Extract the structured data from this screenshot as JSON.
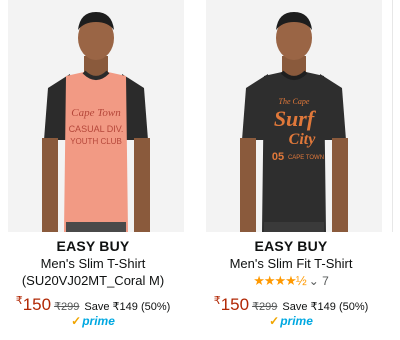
{
  "products": [
    {
      "brand": "EASY BUY",
      "title_line1": "Men's Slim T-Shirt",
      "title_line2": "(SU20VJ02MT_Coral M)",
      "currency": "₹",
      "price": "150",
      "mrp": "₹299",
      "save": "Save ₹149 (50%)",
      "prime": "prime",
      "shirt_print": [
        "Cape Town",
        "CASUAL DIV.",
        "YOUTH CLUB"
      ],
      "body_color": "#f29a84",
      "sleeve_color": "#2b2b2b",
      "print_color": "#b5473a"
    },
    {
      "brand": "EASY BUY",
      "title_line1": "Men's Slim Fit T-Shirt",
      "rating_value": 4.5,
      "stars": "★★★★½",
      "rating_sep": "⌄",
      "rating_count": "7",
      "currency": "₹",
      "price": "150",
      "mrp": "₹299",
      "save": "Save ₹149 (50%)",
      "prime": "prime",
      "shirt_print": [
        "The Cape",
        "Surf",
        "City",
        "05",
        "CAPE TOWN"
      ],
      "body_color": "#2e2e2e",
      "sleeve_color": "#2e2e2e",
      "print_color": "#e0783a"
    }
  ]
}
